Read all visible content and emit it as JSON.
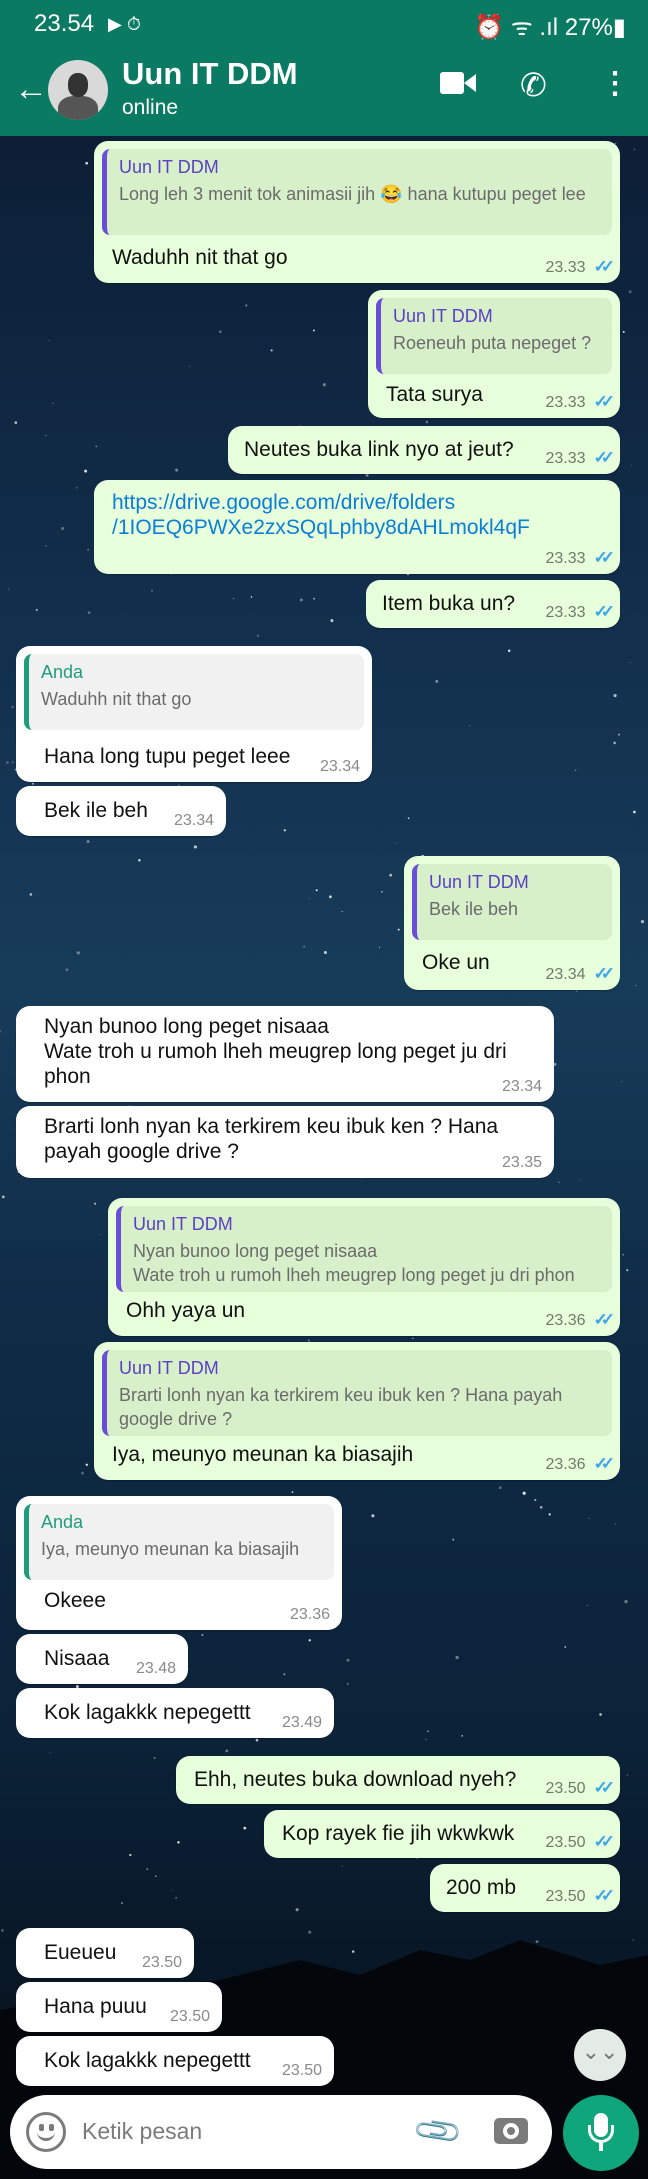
{
  "status_bar": {
    "time": "23.54",
    "icons_left": "▶ ⏱",
    "battery": "27%",
    "icons_right": "⏰ ᯤ .ıl 27%▮"
  },
  "header": {
    "contact_name": "Uun IT DDM",
    "status": "online",
    "back_icon": "←",
    "call_icon": "✆",
    "more_icon": "⋮"
  },
  "messages": [
    {
      "dir": "out",
      "quote": {
        "name": "Uun IT DDM",
        "text": "Long leh 3 menit tok animasii jih 😂 hana kutupu peget lee"
      },
      "text": "Waduhh nit that go",
      "time": "23.33",
      "ticks": "✓✓"
    },
    {
      "dir": "out",
      "quote": {
        "name": "Uun IT DDM",
        "text": "Roeneuh puta nepeget ?"
      },
      "text": "Tata surya",
      "time": "23.33",
      "ticks": "✓✓"
    },
    {
      "dir": "out",
      "text": "Neutes buka link nyo at jeut?",
      "time": "23.33",
      "ticks": "✓✓"
    },
    {
      "dir": "out",
      "link": "https://drive.google.com/drive/folders\n/1IOEQ6PWXe2zxSQqLphby8dAHLmokl4qF",
      "time": "23.33",
      "ticks": "✓✓"
    },
    {
      "dir": "out",
      "text": "Item buka un?",
      "time": "23.33",
      "ticks": "✓✓"
    },
    {
      "dir": "in",
      "quote": {
        "name": "Anda",
        "text": "Waduhh nit that go"
      },
      "text": "Hana long tupu peget leee",
      "time": "23.34"
    },
    {
      "dir": "in",
      "text": "Bek ile beh",
      "time": "23.34"
    },
    {
      "dir": "out",
      "quote": {
        "name": "Uun IT DDM",
        "text": "Bek ile beh"
      },
      "text": "Oke un",
      "time": "23.34",
      "ticks": "✓✓"
    },
    {
      "dir": "in",
      "text": "Nyan bunoo long peget nisaaa\nWate troh u rumoh lheh meugrep long peget ju dri\nphon",
      "time": "23.34"
    },
    {
      "dir": "in",
      "text": "Brarti lonh nyan ka terkirem keu ibuk ken ? Hana\npayah google drive ?",
      "time": "23.35"
    },
    {
      "dir": "out",
      "quote": {
        "name": "Uun IT DDM",
        "text": "Nyan bunoo long peget nisaaa\nWate troh u rumoh lheh meugrep long peget ju dri phon"
      },
      "text": "Ohh yaya un",
      "time": "23.36",
      "ticks": "✓✓"
    },
    {
      "dir": "out",
      "quote": {
        "name": "Uun IT DDM",
        "text": "Brarti lonh nyan ka terkirem keu ibuk ken ? Hana payah\ngoogle drive ?"
      },
      "text": "Iya, meunyo meunan ka biasajih",
      "time": "23.36",
      "ticks": "✓✓"
    },
    {
      "dir": "in",
      "quote": {
        "name": "Anda",
        "text": "Iya, meunyo meunan ka biasajih"
      },
      "text": "Okeee",
      "time": "23.36"
    },
    {
      "dir": "in",
      "text": "Nisaaa",
      "time": "23.48"
    },
    {
      "dir": "in",
      "text": "Kok lagakkk nepegettt",
      "time": "23.49"
    },
    {
      "dir": "out",
      "text": "Ehh, neutes buka download nyeh?",
      "time": "23.50",
      "ticks": "✓✓"
    },
    {
      "dir": "out",
      "text": "Kop rayek fie jih wkwkwk",
      "time": "23.50",
      "ticks": "✓✓"
    },
    {
      "dir": "out",
      "text": "200 mb",
      "time": "23.50",
      "ticks": "✓✓"
    },
    {
      "dir": "in",
      "text": "Eueueu",
      "time": "23.50"
    },
    {
      "dir": "in",
      "text": "Hana puuu",
      "time": "23.50"
    },
    {
      "dir": "in",
      "text": "Kok lagakkk nepegettt",
      "time": "23.50"
    }
  ],
  "input": {
    "placeholder": "Ketik pesan"
  },
  "icons": {
    "scroll_down": "double-chevron-down-icon",
    "emoji": "emoji-icon",
    "attach": "paperclip-icon",
    "camera": "camera-icon",
    "mic": "microphone-icon"
  },
  "colors": {
    "header": "#0a7a63",
    "outgoing": "#e7ffdb",
    "incoming": "#ffffff",
    "read_tick": "#3ca6e8",
    "mic": "#0fa67b"
  }
}
